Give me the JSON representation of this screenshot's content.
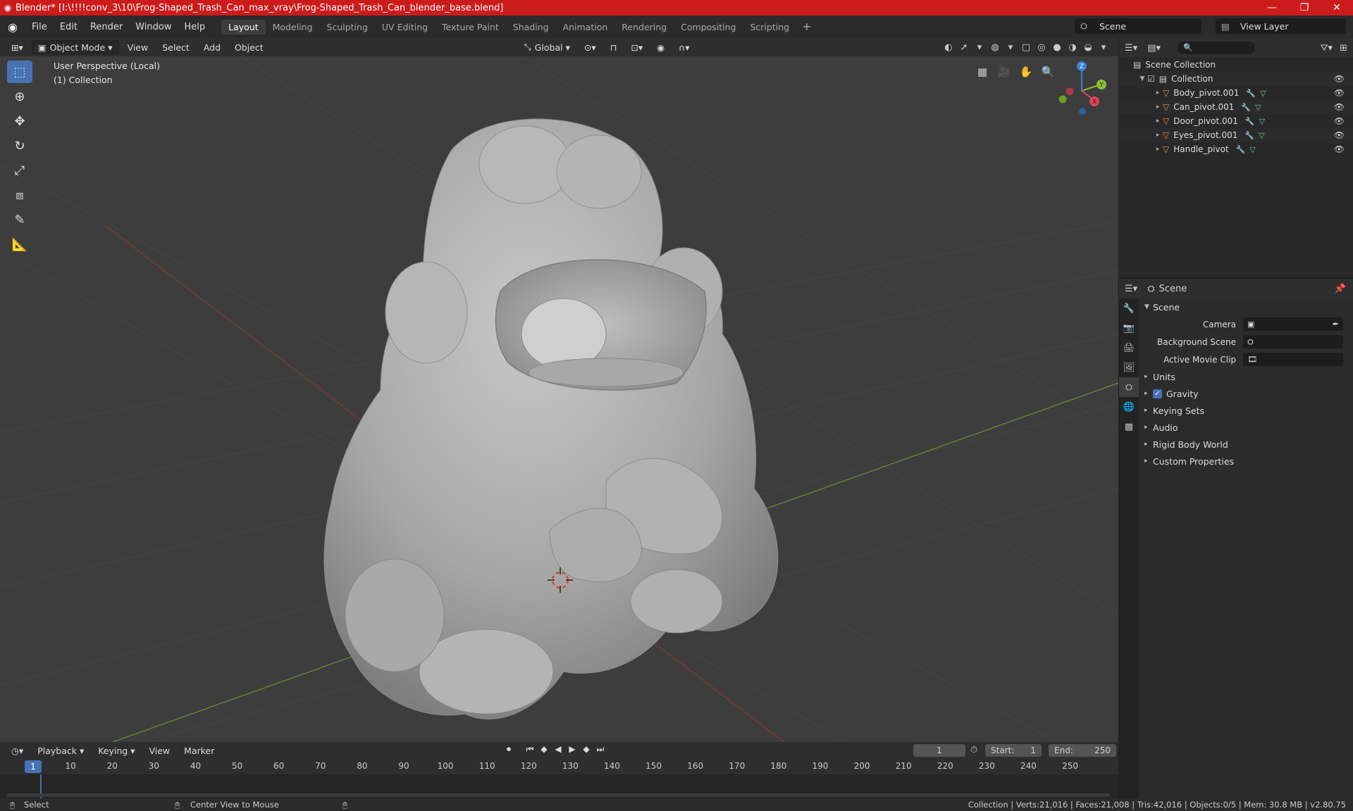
{
  "window": {
    "title": "Blender* [I:\\!!!!conv_3\\10\\Frog-Shaped_Trash_Can_max_vray\\Frog-Shaped_Trash_Can_blender_base.blend]"
  },
  "menu": [
    "File",
    "Edit",
    "Render",
    "Window",
    "Help"
  ],
  "workspaces": [
    "Layout",
    "Modeling",
    "Sculpting",
    "UV Editing",
    "Texture Paint",
    "Shading",
    "Animation",
    "Rendering",
    "Compositing",
    "Scripting"
  ],
  "active_workspace": "Layout",
  "scene_name": "Scene",
  "view_layer": "View Layer",
  "viewport": {
    "mode": "Object Mode",
    "menus": [
      "View",
      "Select",
      "Add",
      "Object"
    ],
    "orientation": "Global",
    "perspective_label": "User Perspective (Local)",
    "collection_label": "(1) Collection",
    "gizmo_axes": {
      "x": "X",
      "y": "Y",
      "z": "Z"
    }
  },
  "outliner": {
    "root": "Scene Collection",
    "collection": "Collection",
    "items": [
      "Body_pivot.001",
      "Can_pivot.001",
      "Door_pivot.001",
      "Eyes_pivot.001",
      "Handle_pivot"
    ]
  },
  "properties": {
    "header_title": "Scene",
    "panel_title": "Scene",
    "camera_label": "Camera",
    "background_scene_label": "Background Scene",
    "active_movie_clip_label": "Active Movie Clip",
    "sections": [
      "Units",
      "Gravity",
      "Keying Sets",
      "Audio",
      "Rigid Body World",
      "Custom Properties"
    ],
    "gravity_checked": true
  },
  "timeline": {
    "menus": [
      "Playback",
      "Keying",
      "View",
      "Marker"
    ],
    "current_frame": "1",
    "start_label": "Start:",
    "start_value": "1",
    "end_label": "End:",
    "end_value": "250",
    "ticks": [
      "10",
      "20",
      "30",
      "40",
      "50",
      "60",
      "70",
      "80",
      "90",
      "100",
      "110",
      "120",
      "130",
      "140",
      "150",
      "160",
      "170",
      "180",
      "190",
      "200",
      "210",
      "220",
      "230",
      "240",
      "250"
    ]
  },
  "statusbar": {
    "left_action": "Select",
    "mid_action": "Center View to Mouse",
    "stats": "Collection | Verts:21,016 | Faces:21,008 | Tris:42,016 | Objects:0/5 | Mem: 30.8 MB | v2.80.75"
  }
}
